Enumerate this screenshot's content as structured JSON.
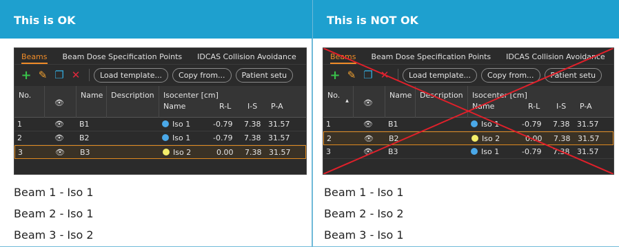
{
  "left": {
    "title": "This is OK",
    "rows": [
      {
        "no": "1",
        "name": "B1",
        "iso": "Iso 1",
        "iso_color": "#4aa8e8",
        "rl": "-0.79",
        "is": "7.38",
        "pa": "31.57",
        "selected": false
      },
      {
        "no": "2",
        "name": "B2",
        "iso": "Iso 1",
        "iso_color": "#4aa8e8",
        "rl": "-0.79",
        "is": "7.38",
        "pa": "31.57",
        "selected": false
      },
      {
        "no": "3",
        "name": "B3",
        "iso": "Iso 2",
        "iso_color": "#f4ee6a",
        "rl": "0.00",
        "is": "7.38",
        "pa": "31.57",
        "selected": true
      }
    ],
    "lines": [
      "Beam 1 - Iso 1",
      "Beam 2 - Iso 1",
      "Beam 3 - Iso 2"
    ]
  },
  "right": {
    "title": "This is NOT OK",
    "rows": [
      {
        "no": "1",
        "name": "B1",
        "iso": "Iso 1",
        "iso_color": "#4aa8e8",
        "rl": "-0.79",
        "is": "7.38",
        "pa": "31.57",
        "selected": false
      },
      {
        "no": "2",
        "name": "B2",
        "iso": "Iso 2",
        "iso_color": "#f4ee6a",
        "rl": "0.00",
        "is": "7.38",
        "pa": "31.57",
        "selected": true
      },
      {
        "no": "3",
        "name": "B3",
        "iso": "Iso 1",
        "iso_color": "#4aa8e8",
        "rl": "-0.79",
        "is": "7.38",
        "pa": "31.57",
        "selected": false
      }
    ],
    "lines": [
      "Beam 1 - Iso 1",
      "Beam 2 - Iso 2",
      "Beam 3 - Iso 1"
    ]
  },
  "ui": {
    "tabs": [
      "Beams",
      "Beam Dose Specification Points",
      "IDCAS Collision Avoidance"
    ],
    "toolbar": {
      "load_template": "Load template...",
      "copy_from": "Copy from...",
      "patient_setup": "Patient setu"
    },
    "columns": {
      "no": "No.",
      "name": "Name",
      "description": "Description",
      "isocenter": "Isocenter [cm]",
      "iso_name": "Name",
      "rl": "R-L",
      "is": "I-S",
      "pa": "P-A"
    }
  },
  "colors": {
    "header": "#1ea0cf",
    "cross": "#e0202a",
    "selection": "#e08a20"
  }
}
